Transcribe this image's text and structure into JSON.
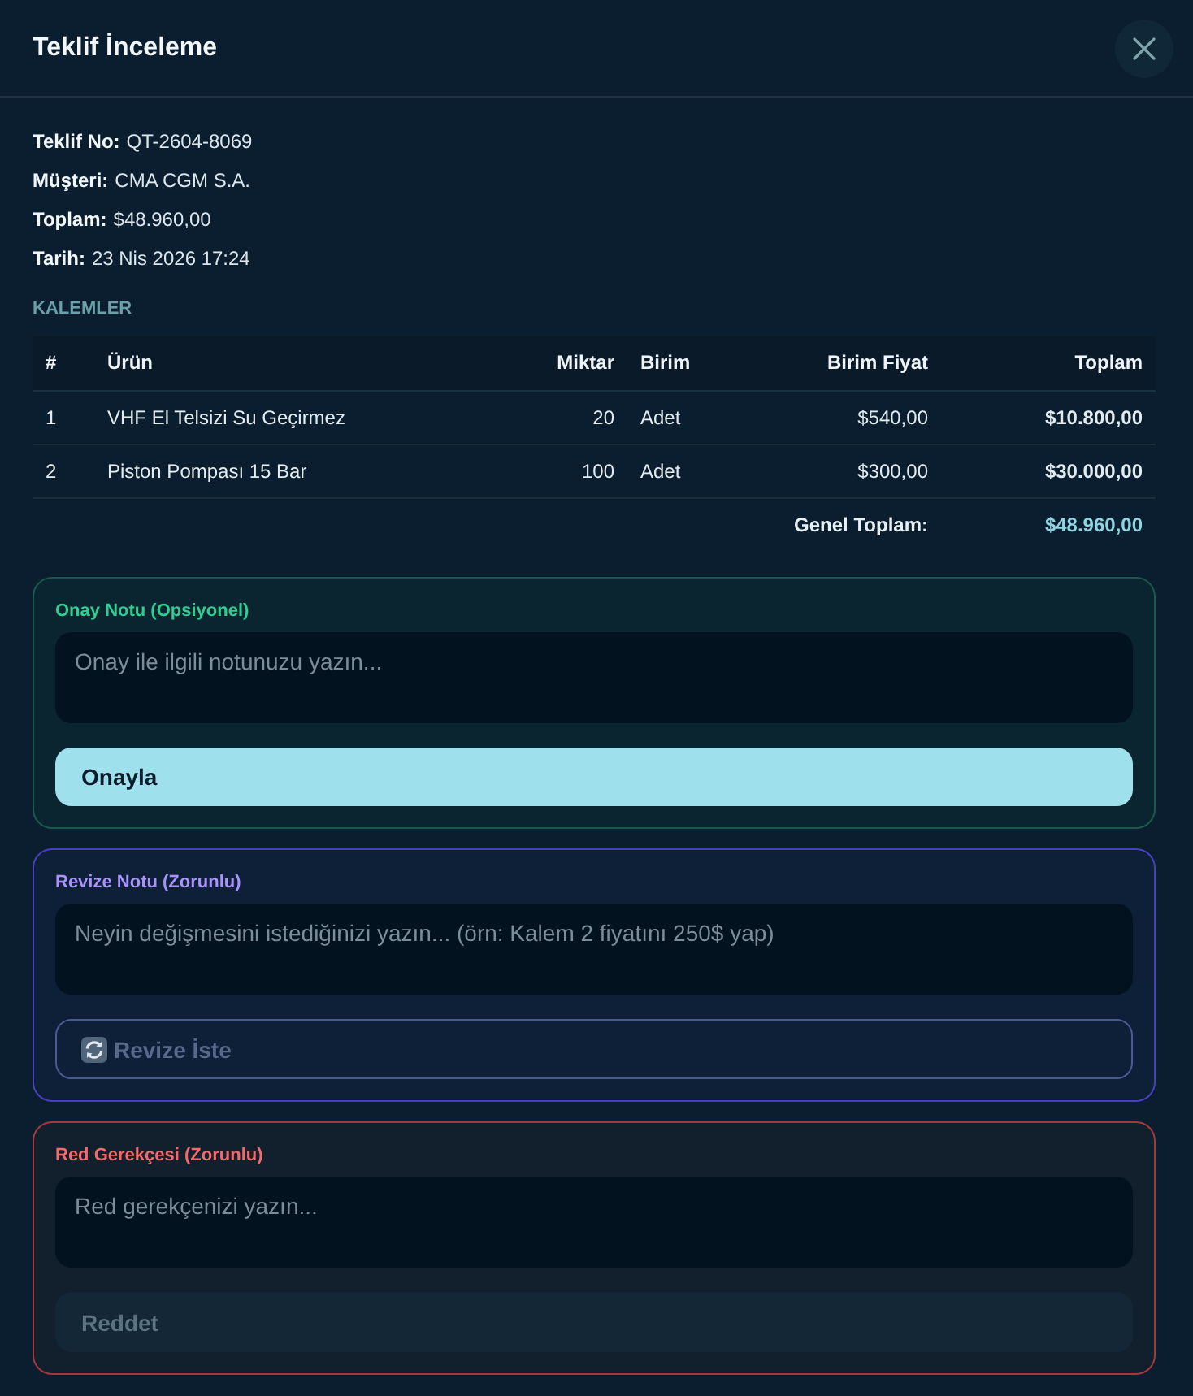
{
  "dialog": {
    "title": "Teklif İnceleme"
  },
  "details": [
    {
      "label": "Teklif No:",
      "value": "QT-2604-8069"
    },
    {
      "label": "Müşteri:",
      "value": "CMA CGM S.A."
    },
    {
      "label": "Toplam:",
      "value": "$48.960,00"
    },
    {
      "label": "Tarih:",
      "value": "23 Nis 2026 17:24"
    }
  ],
  "items": {
    "heading": "KALEMLER",
    "columns": [
      {
        "label": "#",
        "kind": "index"
      },
      {
        "label": "Ürün",
        "kind": "text"
      },
      {
        "label": "Miktar",
        "kind": "number"
      },
      {
        "label": "Birim",
        "kind": "text"
      },
      {
        "label": "Birim Fiyat",
        "kind": "number"
      },
      {
        "label": "Toplam",
        "kind": "total"
      }
    ],
    "rows": [
      [
        "1",
        "VHF El Telsizi Su Geçirmez",
        "20",
        "Adet",
        "$540,00",
        "$10.800,00"
      ],
      [
        "2",
        "Piston Pompası 15 Bar",
        "100",
        "Adet",
        "$300,00",
        "$30.000,00"
      ]
    ],
    "footer": {
      "label": "Genel Toplam:",
      "value": "$48.960,00"
    }
  },
  "sections": [
    {
      "kind": "approve",
      "label": "Onay Notu (Opsiyonel)",
      "placeholder": "Onay ile ilgili notunuzu yazın...",
      "button": {
        "label": "Onayla",
        "disabled": false
      }
    },
    {
      "kind": "revise",
      "label": "Revize Notu (Zorunlu)",
      "placeholder": "Neyin değişmesini istediğinizi yazın... (örn: Kalem 2 fiyatını 250$ yap)",
      "button": {
        "label": "Revize İste",
        "disabled": true
      }
    },
    {
      "kind": "reject",
      "label": "Red Gerekçesi (Zorunlu)",
      "placeholder": "Red gerekçenizi yazın...",
      "button": {
        "label": "Reddet",
        "disabled": true
      }
    }
  ]
}
